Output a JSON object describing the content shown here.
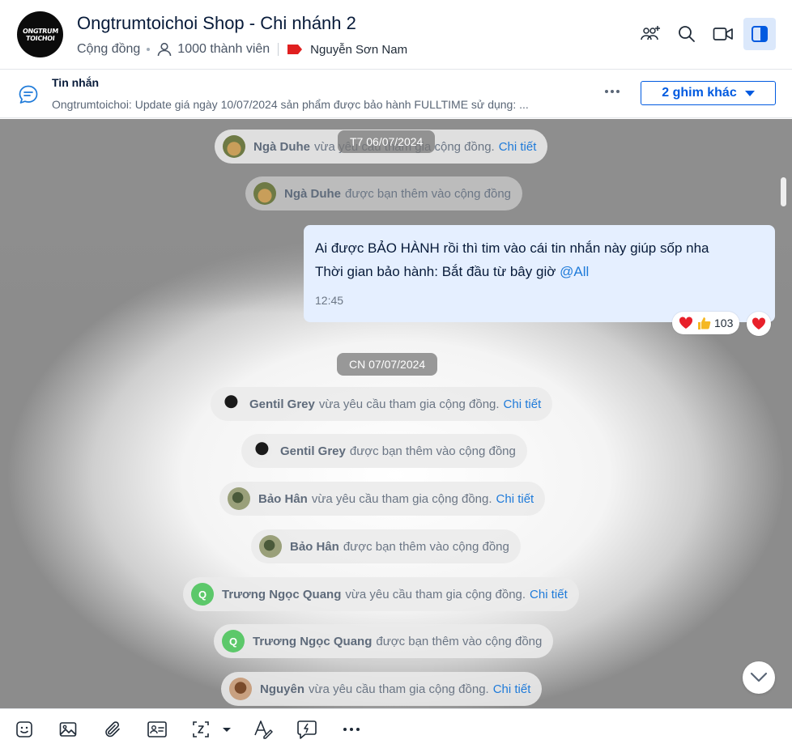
{
  "header": {
    "avatar_text_line1": "ONGTRUM",
    "avatar_text_line2": "TOICHOI",
    "title": "Ongtrumtoichoi Shop - Chi nhánh 2",
    "type_label": "Cộng đồng",
    "member_count": "1000 thành viên",
    "owner_name": "Nguyễn Sơn Nam",
    "icons": [
      "add-member-icon",
      "search-icon",
      "video-call-icon",
      "sidebar-toggle-icon"
    ]
  },
  "pinned": {
    "label": "Tin nhắn",
    "text": "Ongtrumtoichoi: Update giá ngày 10/07/2024 sản phẩm được bảo hành FULLTIME sử dụng: ...",
    "more_pins_label": "2 ghim khác"
  },
  "chat": {
    "date1": "T7 06/07/2024",
    "date2": "CN 07/07/2024",
    "events": [
      {
        "name": "Ngà Duhe",
        "action": "vừa yêu cầu tham gia cộng đồng.",
        "link": "Chi tiết"
      },
      {
        "name": "Ngà Duhe",
        "action": "được bạn thêm vào cộng đồng",
        "link": ""
      },
      {
        "name": "Gentil Grey",
        "action": "vừa yêu cầu tham gia cộng đồng.",
        "link": "Chi tiết"
      },
      {
        "name": "Gentil Grey",
        "action": "được bạn thêm vào cộng đồng",
        "link": ""
      },
      {
        "name": "Bảo Hân",
        "action": "vừa yêu cầu tham gia cộng đồng.",
        "link": "Chi tiết"
      },
      {
        "name": "Bảo Hân",
        "action": "được bạn thêm vào cộng đồng",
        "link": ""
      },
      {
        "name": "Trương Ngọc Quang",
        "action": "vừa yêu cầu tham gia cộng đồng.",
        "link": "Chi tiết",
        "avatar_letter": "Q"
      },
      {
        "name": "Trương Ngọc Quang",
        "action": "được bạn thêm vào cộng đồng",
        "link": "",
        "avatar_letter": "Q"
      },
      {
        "name": "Nguyên",
        "action": "vừa yêu cầu tham gia cộng đồng.",
        "link": "Chi tiết"
      }
    ],
    "message": {
      "line1": "Ai được BẢO HÀNH rồi thì tim vào cái tin nhắn này giúp sốp nha",
      "line2_prefix": "Thời gian bảo hành: Bắt đầu từ bây giờ",
      "mention": "@All",
      "time": "12:45",
      "reaction_count": "103"
    }
  },
  "toolbar": {
    "icons": [
      "sticker-icon",
      "image-icon",
      "attachment-icon",
      "contact-card-icon",
      "screenshot-icon",
      "format-text-icon",
      "quick-message-icon",
      "more-icon"
    ]
  },
  "colors": {
    "accent": "#005ae0",
    "link": "#1e7ad9",
    "bubble": "#e5efff",
    "active_icon_bg": "#dbe8fb"
  }
}
